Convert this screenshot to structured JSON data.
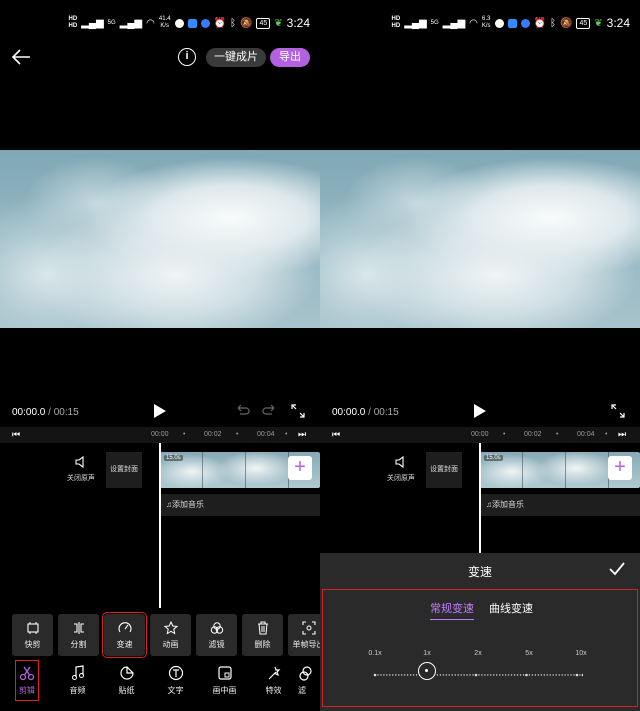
{
  "status": {
    "left_speed": "41.4",
    "right_speed": "6.3",
    "speed_unit": "K/s",
    "battery": "45",
    "time": "3:24",
    "hd_top": "HD",
    "hd_bottom": "HD",
    "net_4g": "4G",
    "net_5g": "5G"
  },
  "header": {
    "info_label": "i",
    "quick_label": "一键成片",
    "export_label": "导出"
  },
  "playback": {
    "current": "00:00.0",
    "separator": " / ",
    "duration": "00:15"
  },
  "ruler": {
    "marks": [
      "00:00",
      "00:02",
      "00:04"
    ]
  },
  "track": {
    "mute_label": "关闭原声",
    "cover_label": "设置封面",
    "clip_duration": "15.0s",
    "add_music_label": "添加音乐",
    "add_clip_label": "+"
  },
  "tools": [
    {
      "label": "快剪",
      "icon": "quick-cut-icon"
    },
    {
      "label": "分割",
      "icon": "split-icon"
    },
    {
      "label": "变速",
      "icon": "speedometer-icon"
    },
    {
      "label": "动画",
      "icon": "animation-icon"
    },
    {
      "label": "滤镜",
      "icon": "filter-icon"
    },
    {
      "label": "删除",
      "icon": "trash-icon"
    },
    {
      "label": "单帧导出",
      "icon": "frame-export-icon"
    }
  ],
  "tabs": [
    {
      "label": "剪辑",
      "icon": "scissors-icon"
    },
    {
      "label": "音频",
      "icon": "music-note-icon"
    },
    {
      "label": "贴纸",
      "icon": "sticker-icon"
    },
    {
      "label": "文字",
      "icon": "text-icon"
    },
    {
      "label": "画中画",
      "icon": "pip-icon"
    },
    {
      "label": "特效",
      "icon": "effects-icon"
    },
    {
      "label": "滤",
      "icon": "filter-icon"
    }
  ],
  "speed_panel": {
    "title": "变速",
    "tab_normal": "常规变速",
    "tab_curve": "曲线变速",
    "labels": [
      "0.1x",
      "1x",
      "2x",
      "5x",
      "10x"
    ],
    "current_index": 1
  },
  "colors": {
    "accent": "#b262e0",
    "accent_text": "#c27aff",
    "highlight_box": "#e02020",
    "panel": "#2a2a2a"
  }
}
